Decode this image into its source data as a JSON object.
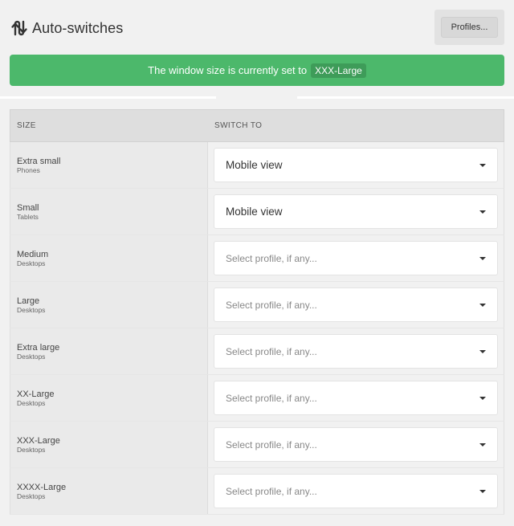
{
  "header": {
    "title": "Auto-switches",
    "title_icon": "swap-arrows-icon",
    "profiles_button": "Profiles..."
  },
  "banner": {
    "text": "The window size is currently set to",
    "current_size": "XXX-Large",
    "color": "#4cb86b"
  },
  "table": {
    "col_size": "SIZE",
    "col_switch": "SWITCH TO",
    "rows": [
      {
        "name": "Extra small",
        "sub": "Phones",
        "value": "Mobile view",
        "placeholder": "",
        "filled": true
      },
      {
        "name": "Small",
        "sub": "Tablets",
        "value": "Mobile view",
        "placeholder": "",
        "filled": true
      },
      {
        "name": "Medium",
        "sub": "Desktops",
        "value": "",
        "placeholder": "Select profile, if any...",
        "filled": false
      },
      {
        "name": "Large",
        "sub": "Desktops",
        "value": "",
        "placeholder": "Select profile, if any...",
        "filled": false
      },
      {
        "name": "Extra large",
        "sub": "Desktops",
        "value": "",
        "placeholder": "Select profile, if any...",
        "filled": false
      },
      {
        "name": "XX-Large",
        "sub": "Desktops",
        "value": "",
        "placeholder": "Select profile, if any...",
        "filled": false
      },
      {
        "name": "XXX-Large",
        "sub": "Desktops",
        "value": "",
        "placeholder": "Select profile, if any...",
        "filled": false
      },
      {
        "name": "XXXX-Large",
        "sub": "Desktops",
        "value": "",
        "placeholder": "Select profile, if any...",
        "filled": false
      }
    ]
  }
}
